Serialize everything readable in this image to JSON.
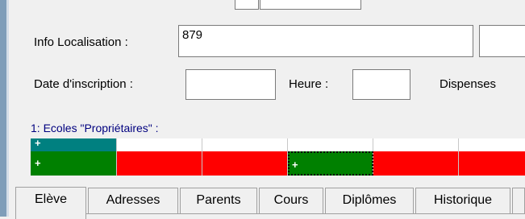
{
  "form": {
    "info_localisation_label": "Info Localisation :",
    "info_localisation_value": "879",
    "date_inscription_label": "Date d'inscription :",
    "date_inscription_value": "",
    "heure_label": "Heure :",
    "heure_value": "",
    "dispenses_label": "Dispenses",
    "section_title": "1: Ecoles \"Propriétaires\" :"
  },
  "grid": {
    "header_symbol": "+",
    "row_symbol": "+",
    "selected_symbol": "+",
    "colors": {
      "teal": "#008080",
      "green": "#008000",
      "red": "#ff0000"
    }
  },
  "tabs": [
    {
      "label": "Elève",
      "active": true
    },
    {
      "label": "Adresses",
      "active": false
    },
    {
      "label": "Parents",
      "active": false
    },
    {
      "label": "Cours",
      "active": false
    },
    {
      "label": "Diplômes",
      "active": false
    },
    {
      "label": "Historique",
      "active": false
    }
  ]
}
